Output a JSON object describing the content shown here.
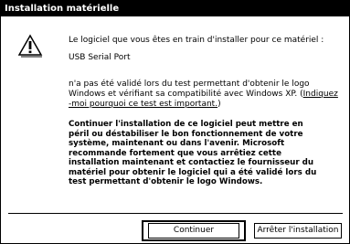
{
  "window": {
    "title": "Installation matérielle"
  },
  "message": {
    "intro": "Le logiciel que vous êtes en train d'installer pour ce matériel :",
    "device": "USB Serial Port",
    "validation_lines": [
      "n'a pas été validé lors du test permettant d'obtenir le logo",
      "Windows et vérifiant sa compatibilité avec Windows XP. ("
    ],
    "link_part1": "Indiquez",
    "link_part2": "-moi pourquoi ce test est important.",
    "link_close": ")",
    "warning_lines": [
      "Continuer l'installation de ce logiciel peut mettre en",
      "péril ou déstabiliser le bon fonctionnement de votre",
      "système, maintenant ou dans l'avenir. Microsoft",
      "recommande fortement que vous arrêtiez cette",
      "installation maintenant et contactiez le fournisseur du",
      "matériel pour obtenir le logiciel qui a été validé lors du",
      "test permettant d'obtenir le logo Windows."
    ]
  },
  "buttons": {
    "continue": "Continuer",
    "stop": "Arrêter l'installation"
  },
  "icons": {
    "warning": "warning-triangle-icon"
  }
}
